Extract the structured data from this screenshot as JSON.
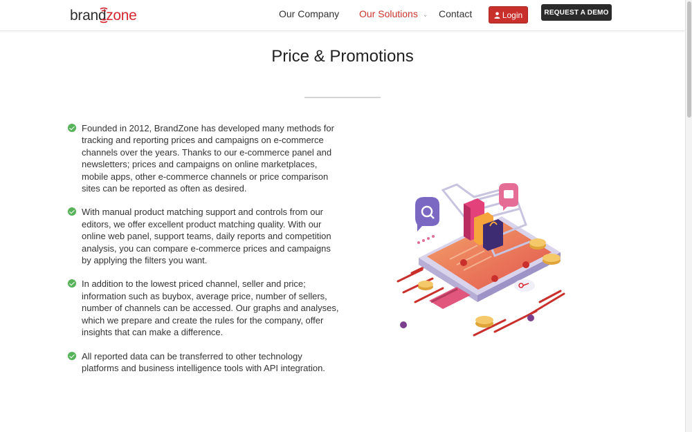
{
  "header": {
    "logo": {
      "part1": "brand",
      "part2": "zone"
    },
    "nav": [
      {
        "label": "Our Company"
      },
      {
        "label": "Our Solutions",
        "active": true
      },
      {
        "label": "Contact"
      }
    ],
    "login_label": "Login",
    "demo_label": "REQUEST A DEMO"
  },
  "page": {
    "title": "Price & Promotions",
    "features": [
      "Founded in 2012, BrandZone has developed many methods for tracking and reporting prices and campaigns on e-commerce channels over the years. Thanks to our e-commerce panel and newsletters; prices and campaigns on online marketplaces, mobile apps, other e-commerce channels or price comparison sites can be reported as often as desired.",
      "With manual product matching support and controls from our editors, we offer excellent product matching quality. With our online web panel, support teams, daily reports and competition analysis, you can compare e-commerce prices and campaigns by applying the filters you want.",
      "In addition to the lowest priced channel, seller and price; information such as buybox, average price, number of sellers, number of channels can be accessed. Our graphs and analyses, which we prepare and create the rules for the company, offer insights that can make a difference.",
      "All reported data can be transferred to other technology platforms and business intelligence tools with API integration."
    ]
  },
  "icons": {
    "check": "check-circle-icon",
    "user": "user-icon",
    "chevron": "chevron-down-icon"
  },
  "colors": {
    "brand_red": "#c9302c",
    "dark": "#2b2b2b",
    "check_green": "#57b35a"
  }
}
